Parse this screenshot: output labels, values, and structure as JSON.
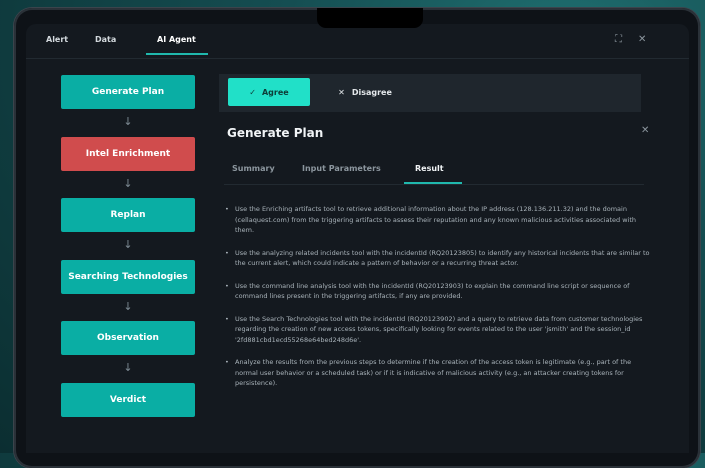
{
  "tabs": [
    {
      "label": "Alert",
      "active": false
    },
    {
      "label": "Data",
      "active": false
    },
    {
      "label": "AI Agent",
      "active": true
    }
  ],
  "window_icons": {
    "expand": "⛶",
    "close": "✕"
  },
  "flow": {
    "steps": [
      {
        "label": "Generate Plan",
        "status": "normal",
        "color": "#0aaea4"
      },
      {
        "label": "Intel Enrichment",
        "status": "selected",
        "color": "#d04c4d"
      },
      {
        "label": "Replan",
        "status": "normal",
        "color": "#0aaea4"
      },
      {
        "label": "Searching Technologies",
        "status": "normal",
        "color": "#0aaea4"
      },
      {
        "label": "Observation",
        "status": "normal",
        "color": "#0aaea4"
      },
      {
        "label": "Verdict",
        "status": "normal",
        "color": "#0aaea4"
      }
    ],
    "arrow_glyph": "↓"
  },
  "feedback": {
    "agree_label": "Agree",
    "agree_icon": "✓",
    "disagree_label": "Disagree",
    "disagree_icon": "✕"
  },
  "panel": {
    "title": "Generate Plan",
    "close_icon": "✕",
    "subtabs": [
      {
        "label": "Summary",
        "active": false
      },
      {
        "label": "Input Parameters",
        "active": false
      },
      {
        "label": "Result",
        "active": true
      }
    ],
    "results": [
      "Use the Enriching artifacts tool to retrieve additional information about the IP address (128.136.211.32) and the domain (cellaquest.com) from the triggering artifacts to assess their reputation and any known malicious activities associated with them.",
      "Use the analyzing related incidents tool with the incidentId (RQ20123805) to identify any historical incidents that are similar to the current alert, which could indicate a pattern of behavior or a recurring threat actor.",
      "Use the command line analysis tool with the incidentId (RQ20123903) to explain the command line script or sequence of command lines present in the triggering artifacts, if any are provided.",
      "Use the Search Technologies tool with the incidentId (RQ20123902) and a query to retrieve data from customer technologies regarding the creation of new access tokens, specifically looking for events related to the user 'jsmith' and the session_id '2fd881cbd1ecd55268e64bed248d6e'.",
      "Analyze the results from the previous steps to determine if the creation of the access token is legitimate (e.g., part of the normal user behavior or a scheduled task) or if it is indicative of malicious activity (e.g., an attacker creating tokens for persistence)."
    ]
  },
  "colors": {
    "accent": "#20b8ad",
    "agree_bg": "#21e0c8",
    "flow_teal": "#0aaea4",
    "flow_red": "#d04c4d",
    "background": "#14191f"
  }
}
